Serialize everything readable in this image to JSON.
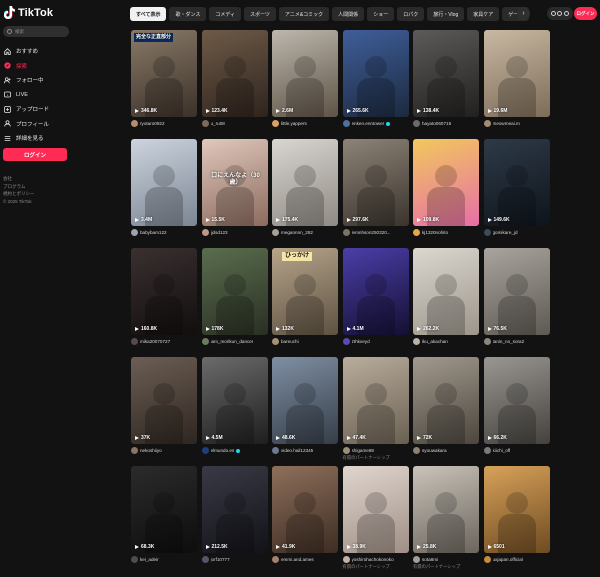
{
  "app": {
    "name": "TikTok"
  },
  "sidebar": {
    "search_placeholder": "検索",
    "items": [
      {
        "label": "おすすめ",
        "icon": "home-icon",
        "active": false
      },
      {
        "label": "探索",
        "icon": "compass-icon",
        "active": true
      },
      {
        "label": "フォロー中",
        "icon": "following-icon",
        "active": false
      },
      {
        "label": "LIVE",
        "icon": "live-icon",
        "active": false
      },
      {
        "label": "アップロード",
        "icon": "upload-icon",
        "active": false
      },
      {
        "label": "プロフィール",
        "icon": "profile-icon",
        "active": false
      },
      {
        "label": "詳細を見る",
        "icon": "more-icon",
        "active": false
      }
    ],
    "login_label": "ログイン",
    "footer": [
      "会社",
      "プログラム",
      "規約とポリシー",
      "© 2025 TikTok"
    ]
  },
  "topbar": {
    "categories": [
      "すべて表示",
      "歌・ダンス",
      "コメディ",
      "スポーツ",
      "アニメ&コミック",
      "人間関係",
      "ショー",
      "ロパク",
      "旅行・Vlog",
      "家具ケア",
      "ゲーム"
    ],
    "active_category": 0,
    "login_label": "ログイン"
  },
  "colors": {
    "accent": "#fe2c55",
    "verified": "#20d5ec",
    "background": "#121212"
  },
  "videos": [
    {
      "views": "346.8K",
      "user": "ryotaro0922",
      "verified": false,
      "bg": "#8a7a68",
      "bg2": "#3b3129",
      "av": "#b98c6b",
      "overlay": "完全な正直部分",
      "ov": "tl"
    },
    {
      "views": "123.4K",
      "user": "u_ru08",
      "verified": false,
      "bg": "#6e5a48",
      "bg2": "#2f241d",
      "av": "#7c6b5a"
    },
    {
      "views": "2.6M",
      "user": "little.yappers",
      "verified": false,
      "bg": "#bdb7ad",
      "bg2": "#5e5346",
      "av": "#d7a36b"
    },
    {
      "views": "265.6K",
      "user": "enken.enntower",
      "verified": true,
      "bg": "#3f5e9a",
      "bg2": "#1c2a3f",
      "av": "#4f6f9c"
    },
    {
      "views": "138.4K",
      "user": "hayato060716",
      "verified": false,
      "bg": "#5d5b59",
      "bg2": "#22201f",
      "av": "#6a6a6a"
    },
    {
      "views": "19.6M",
      "user": "meowmeai.m",
      "verified": false,
      "bg": "#c9b9a3",
      "bg2": "#7d6c58",
      "av": "#a38d72"
    },
    {
      "views": "3.4M",
      "user": "babybam122",
      "verified": false,
      "bg": "#cdd4de",
      "bg2": "#7b8593",
      "av": "#9aa3b0"
    },
    {
      "views": "15.5K",
      "user": "jjdsd123",
      "verified": false,
      "bg": "#e0c8bc",
      "bg2": "#8c6b5e",
      "av": "#c49684",
      "overlay": "口にえんなよ（30歳）",
      "ov": "mid"
    },
    {
      "views": "175.4K",
      "user": "megannnn_282",
      "verified": false,
      "bg": "#d9d5d0",
      "bg2": "#8f8a84",
      "av": "#a89f95"
    },
    {
      "views": "297.6K",
      "user": "lemnhson250320...",
      "verified": false,
      "bg": "#8d8377",
      "bg2": "#3b342d",
      "av": "#7d7264"
    },
    {
      "views": "109.8K",
      "user": "kj1320nohito",
      "verified": false,
      "bg": "#f2c85b",
      "bg2": "#e66fa8",
      "av": "#e7a84b"
    },
    {
      "views": "149.6K",
      "user": "gomikare_jd",
      "verified": false,
      "bg": "#2e3a48",
      "bg2": "#0e141b",
      "av": "#3c4a5a"
    },
    {
      "views": "160.8K",
      "user": "mika20070727",
      "verified": false,
      "bg": "#3a3030",
      "bg2": "#120e0e",
      "av": "#5a4848"
    },
    {
      "views": "178K",
      "user": "iam_morikun_dancer",
      "verified": false,
      "bg": "#5a6e4e",
      "bg2": "#2a2f24",
      "av": "#6b7d5f"
    },
    {
      "views": "132K",
      "user": "bareuchi",
      "verified": false,
      "bg": "#b7a58b",
      "bg2": "#5d5141",
      "av": "#a69376",
      "overlay": "ひっかけ",
      "ov": "top"
    },
    {
      "views": "4.1M",
      "user": "zthkxeyd",
      "verified": false,
      "bg": "#4b3ea8",
      "bg2": "#141033",
      "av": "#5a4ab8"
    },
    {
      "views": "262.2K",
      "user": "iku_akachan",
      "verified": false,
      "bg": "#dcd7cf",
      "bg2": "#9c968c",
      "av": "#bab3a6"
    },
    {
      "views": "76.5K",
      "user": "tanin_no_sora2",
      "verified": false,
      "bg": "#a9a49d",
      "bg2": "#5e5953",
      "av": "#8c867e"
    },
    {
      "views": "37K",
      "user": "nekoshiiyo",
      "verified": false,
      "bg": "#6c5e54",
      "bg2": "#2e2620",
      "av": "#8a7464"
    },
    {
      "views": "4.5M",
      "user": "elmundo.es",
      "verified": true,
      "bg": "#6b6b6b",
      "bg2": "#1e1e1e",
      "av": "#1f3d80"
    },
    {
      "views": "48.6K",
      "user": "video.hail12345",
      "verified": false,
      "bg": "#7f8fa3",
      "bg2": "#353d48",
      "av": "#6a7b90"
    },
    {
      "views": "47.4K",
      "user": "shigame88",
      "verified": false,
      "bg": "#b9ad9c",
      "bg2": "#6a6052",
      "av": "#9b8e7b",
      "sub": "有償のパートナーシップ"
    },
    {
      "views": "72K",
      "user": "syouwakara",
      "verified": false,
      "bg": "#a29a8e",
      "bg2": "#4c463e",
      "av": "#8b8275"
    },
    {
      "views": "66.2K",
      "user": "kiichi_off",
      "verified": false,
      "bg": "#9a9792",
      "bg2": "#45423e",
      "av": "#7d7a75"
    },
    {
      "views": "68.3K",
      "user": "kei_adeir",
      "verified": false,
      "bg": "#2b2b2b",
      "bg2": "#0d0d0d",
      "av": "#4d4d4d"
    },
    {
      "views": "212.5K",
      "user": "jorf10777",
      "verified": false,
      "bg": "#3a3a46",
      "bg2": "#121218",
      "av": "#55556a"
    },
    {
      "views": "41.9K",
      "user": "emmi.and.ames",
      "verified": false,
      "bg": "#8e6f5b",
      "bg2": "#3d2d23",
      "av": "#a3816a"
    },
    {
      "views": "38.9K",
      "user": "yoshirohachokonoko",
      "verified": false,
      "bg": "#e0d6cf",
      "bg2": "#9f8f85",
      "av": "#c2b1a5",
      "sub": "有償のパートナーシップ"
    },
    {
      "views": "25.8K",
      "user": "sota8mi",
      "verified": false,
      "bg": "#c9c3ba",
      "bg2": "#6b655d",
      "av": "#a59e93",
      "sub": "有償のパートナーシップ"
    },
    {
      "views": "6501",
      "user": "uxjapan.official",
      "verified": false,
      "bg": "#d8a25a",
      "bg2": "#6e4b22",
      "av": "#c68b3f"
    }
  ]
}
